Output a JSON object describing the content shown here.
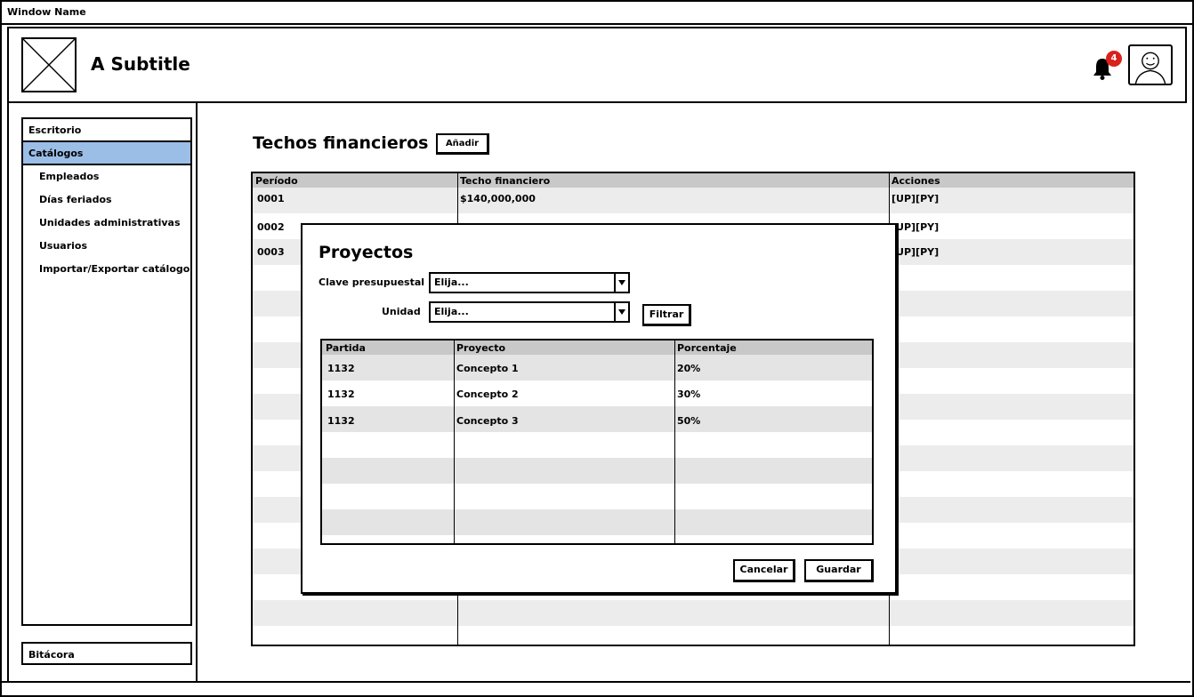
{
  "window": {
    "title": "Window Name"
  },
  "header": {
    "subtitle": "A Subtitle",
    "notification_count": "4"
  },
  "sidebar": {
    "items": [
      {
        "label": "Escritorio"
      },
      {
        "label": "Catálogos"
      },
      {
        "label": "Empleados"
      },
      {
        "label": "Días feriados"
      },
      {
        "label": "Unidades administrativas"
      },
      {
        "label": "Usuarios"
      },
      {
        "label": "Importar/Exportar catálogos"
      }
    ],
    "bottom_item": "Bitácora"
  },
  "main": {
    "title": "Techos financieros",
    "add_label": "Añadir",
    "columns": [
      "Período",
      "Techo financiero",
      "Acciones"
    ],
    "rows": [
      {
        "periodo": "0001",
        "techo": "$140,000,000",
        "acciones": "[UP][PY]"
      },
      {
        "periodo": "0002",
        "techo": "",
        "acciones": "[UP][PY]"
      },
      {
        "periodo": "0003",
        "techo": "",
        "acciones": "[UP][PY]"
      }
    ]
  },
  "modal": {
    "title": "Proyectos",
    "clave_label": "Clave presupuestal",
    "clave_value": "Elija...",
    "unidad_label": "Unidad",
    "unidad_value": "Elija...",
    "filter_label": "Filtrar",
    "columns": [
      "Partida",
      "Proyecto",
      "Porcentaje"
    ],
    "rows": [
      {
        "partida": "1132",
        "proyecto": "Concepto 1",
        "porcentaje": "20%"
      },
      {
        "partida": "1132",
        "proyecto": "Concepto 2",
        "porcentaje": "30%"
      },
      {
        "partida": "1132",
        "proyecto": "Concepto 3",
        "porcentaje": "50%"
      }
    ],
    "cancel_label": "Cancelar",
    "save_label": "Guardar"
  },
  "colors": {
    "selected_nav": "#9bbee7",
    "badge": "#d9221c",
    "header_row": "#c8c8c8",
    "stripe": "#ececec"
  },
  "icons": [
    "image-placeholder-icon",
    "bell-icon",
    "user-avatar-icon",
    "chevron-down-icon"
  ]
}
